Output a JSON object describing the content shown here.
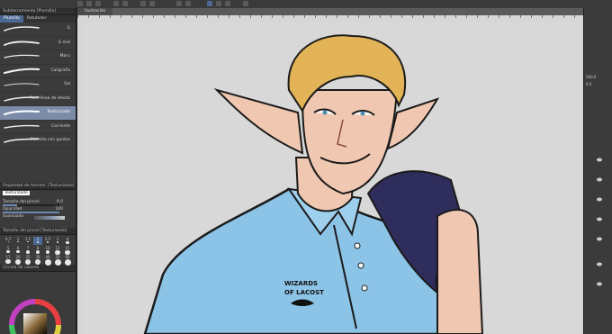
{
  "canvas_tab_label": "Ilustración",
  "subtool_panel": {
    "header": "Subherramienta [Plumilla]",
    "tabs": [
      "Plumilla",
      "Rotulador"
    ],
    "active_tab": 0,
    "brushes": [
      {
        "label": "G"
      },
      {
        "label": "G mal"
      },
      {
        "label": "Maru"
      },
      {
        "label": "Caligrafía"
      },
      {
        "label": "Sal"
      },
      {
        "label": "Para línea de efecto"
      },
      {
        "label": "Texturizado"
      },
      {
        "label": "Corriente"
      },
      {
        "label": "Plumilla con puntos"
      }
    ],
    "selected_index": 6
  },
  "tool_property": {
    "header": "Propiedad de herram. [Texturizado]",
    "preset_name": "Texturizado",
    "brush_size_label": "Tamaño del pincel",
    "brush_size_value": "9.0",
    "brush_size_fill": 0.25,
    "opacity_label": "Opacidad",
    "opacity_value": "100",
    "opacity_fill": 1.0,
    "smoothing_label": "Suavizado"
  },
  "brush_size_panel": {
    "header": "Tamaño del pincel [Texturizado]",
    "sizes": [
      "0.7",
      "1",
      "1.5",
      "2",
      "2.5",
      "3",
      "4",
      "5",
      "6",
      "7",
      "8",
      "10",
      "12",
      "15",
      "17",
      "20",
      "25",
      "30",
      "40",
      "50",
      "60"
    ],
    "selected_index": 3
  },
  "color_panel": {
    "header": "Círculo de colores"
  },
  "right_panel": {
    "value_a": "500.0",
    "value_b": "0.0"
  },
  "artwork": {
    "shirt_text_line1": "WIZARDS",
    "shirt_text_line2": "OF LACOST",
    "colors": {
      "hair": "#e2b457",
      "skin": "#f0c7b0",
      "shirt": "#8cc4e8",
      "jacket": "#2f2d5c",
      "background": "#d8d8d8"
    }
  }
}
